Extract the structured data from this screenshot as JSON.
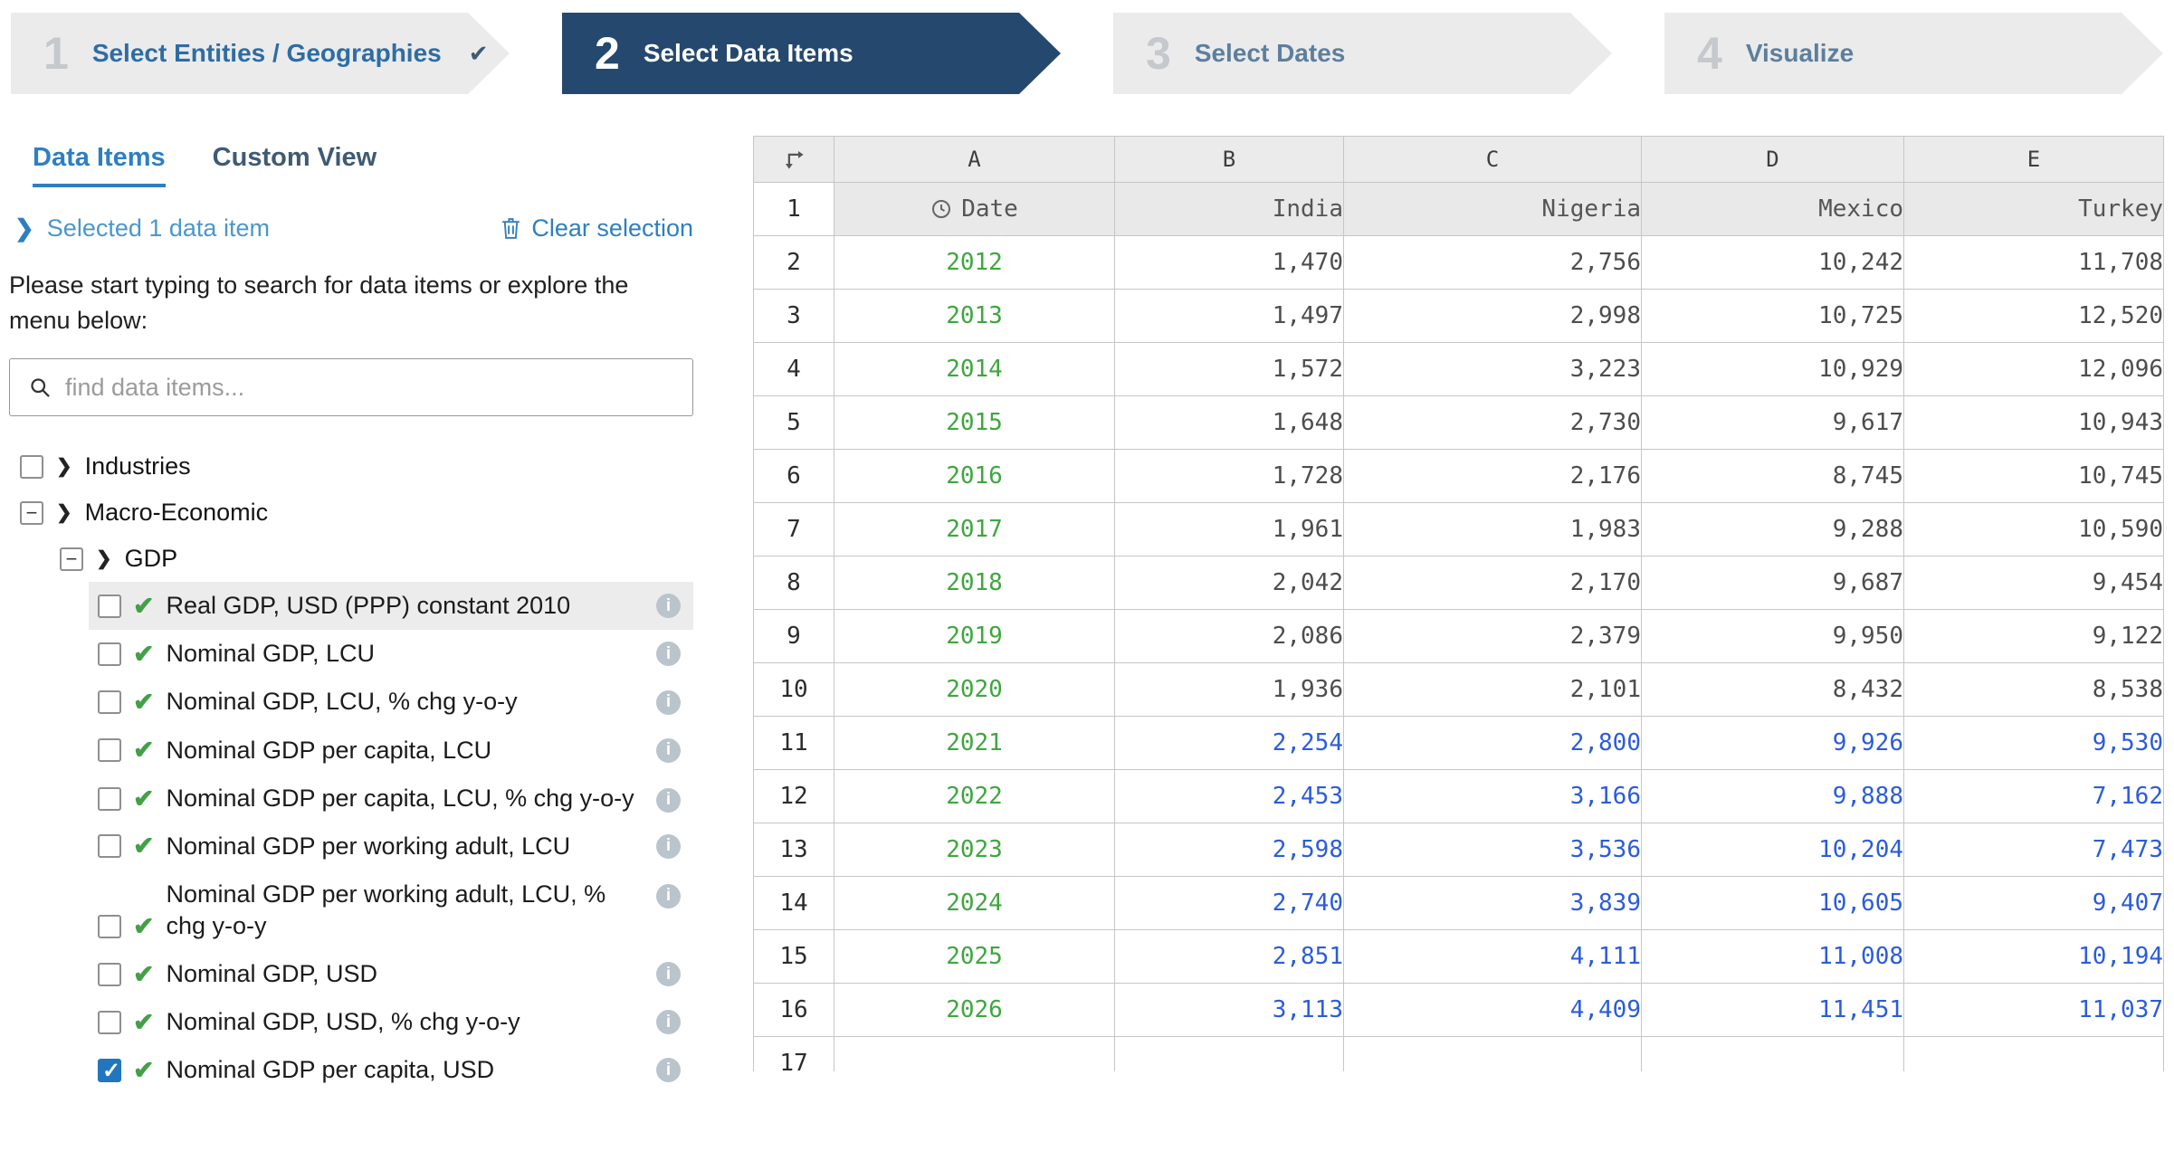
{
  "colors": {
    "accent_blue": "#2e7fc1",
    "active_step_navy": "#24486e",
    "year_green": "#3fa63f",
    "forecast_blue": "#2b5cd9",
    "check_green": "#43a047"
  },
  "stepper": {
    "steps": [
      {
        "number": "1",
        "label": "Select Entities / Geographies",
        "state": "completed",
        "has_check": true
      },
      {
        "number": "2",
        "label": "Select Data Items",
        "state": "active",
        "has_check": false
      },
      {
        "number": "3",
        "label": "Select Dates",
        "state": "upcoming",
        "has_check": false
      },
      {
        "number": "4",
        "label": "Visualize",
        "state": "upcoming",
        "has_check": false
      }
    ]
  },
  "sidebar": {
    "tabs": [
      {
        "label": "Data Items",
        "active": true
      },
      {
        "label": "Custom View",
        "active": false
      }
    ],
    "selection_summary": "Selected 1 data item",
    "clear_selection_label": "Clear selection",
    "instructions": "Please start typing to search for data items or explore the menu below:",
    "search_placeholder": "find data items...",
    "tree": {
      "industries": {
        "label": "Industries",
        "expanded": false
      },
      "macro": {
        "label": "Macro-Economic",
        "expanded": true
      },
      "gdp": {
        "label": "GDP",
        "expanded": true
      },
      "items": [
        {
          "label": "Real GDP, USD (PPP) constant 2010",
          "checked": false,
          "highlighted": true
        },
        {
          "label": "Nominal GDP, LCU",
          "checked": false
        },
        {
          "label": "Nominal GDP, LCU, % chg y-o-y",
          "checked": false
        },
        {
          "label": "Nominal GDP per capita, LCU",
          "checked": false
        },
        {
          "label": "Nominal GDP per capita, LCU, % chg y-o-y",
          "checked": false
        },
        {
          "label": "Nominal GDP per working adult, LCU",
          "checked": false
        },
        {
          "label": "Nominal GDP per working adult, LCU, % chg y-o-y",
          "checked": false
        },
        {
          "label": "Nominal GDP, USD",
          "checked": false
        },
        {
          "label": "Nominal GDP, USD, % chg y-o-y",
          "checked": false
        },
        {
          "label": "Nominal GDP per capita, USD",
          "checked": true
        }
      ]
    }
  },
  "table": {
    "column_letters": [
      "A",
      "B",
      "C",
      "D",
      "E"
    ],
    "header": {
      "row_number": "1",
      "date_label": "Date",
      "entities": [
        "India",
        "Nigeria",
        "Mexico",
        "Turkey"
      ]
    },
    "rows": [
      {
        "row_number": "2",
        "year": "2012",
        "values": [
          "1,470",
          "2,756",
          "10,242",
          "11,708"
        ],
        "forecast": false
      },
      {
        "row_number": "3",
        "year": "2013",
        "values": [
          "1,497",
          "2,998",
          "10,725",
          "12,520"
        ],
        "forecast": false
      },
      {
        "row_number": "4",
        "year": "2014",
        "values": [
          "1,572",
          "3,223",
          "10,929",
          "12,096"
        ],
        "forecast": false
      },
      {
        "row_number": "5",
        "year": "2015",
        "values": [
          "1,648",
          "2,730",
          "9,617",
          "10,943"
        ],
        "forecast": false
      },
      {
        "row_number": "6",
        "year": "2016",
        "values": [
          "1,728",
          "2,176",
          "8,745",
          "10,745"
        ],
        "forecast": false
      },
      {
        "row_number": "7",
        "year": "2017",
        "values": [
          "1,961",
          "1,983",
          "9,288",
          "10,590"
        ],
        "forecast": false
      },
      {
        "row_number": "8",
        "year": "2018",
        "values": [
          "2,042",
          "2,170",
          "9,687",
          "9,454"
        ],
        "forecast": false
      },
      {
        "row_number": "9",
        "year": "2019",
        "values": [
          "2,086",
          "2,379",
          "9,950",
          "9,122"
        ],
        "forecast": false
      },
      {
        "row_number": "10",
        "year": "2020",
        "values": [
          "1,936",
          "2,101",
          "8,432",
          "8,538"
        ],
        "forecast": false
      },
      {
        "row_number": "11",
        "year": "2021",
        "values": [
          "2,254",
          "2,800",
          "9,926",
          "9,530"
        ],
        "forecast": true
      },
      {
        "row_number": "12",
        "year": "2022",
        "values": [
          "2,453",
          "3,166",
          "9,888",
          "7,162"
        ],
        "forecast": true
      },
      {
        "row_number": "13",
        "year": "2023",
        "values": [
          "2,598",
          "3,536",
          "10,204",
          "7,473"
        ],
        "forecast": true
      },
      {
        "row_number": "14",
        "year": "2024",
        "values": [
          "2,740",
          "3,839",
          "10,605",
          "9,407"
        ],
        "forecast": true
      },
      {
        "row_number": "15",
        "year": "2025",
        "values": [
          "2,851",
          "4,111",
          "11,008",
          "10,194"
        ],
        "forecast": true
      },
      {
        "row_number": "16",
        "year": "2026",
        "values": [
          "3,113",
          "4,409",
          "11,451",
          "11,037"
        ],
        "forecast": true
      },
      {
        "row_number": "17",
        "year": "",
        "values": [
          "",
          "",
          "",
          ""
        ],
        "forecast": false
      }
    ]
  }
}
